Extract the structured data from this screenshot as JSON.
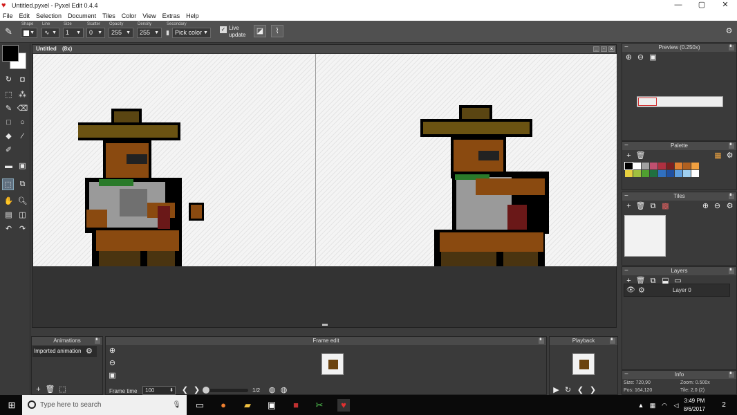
{
  "window": {
    "title": "Untitled.pyxel - Pyxel Edit 0.4.4",
    "minimize": "—",
    "maximize": "▢",
    "close": "✕"
  },
  "menu": [
    "File",
    "Edit",
    "Selection",
    "Document",
    "Tiles",
    "Color",
    "View",
    "Extras",
    "Help"
  ],
  "toolbar": {
    "shape_label": "Shape",
    "line_label": "Line",
    "size_label": "Size",
    "size_value": "1",
    "scatter_label": "Scatter",
    "scatter_value": "0",
    "opacity_label": "Opacity",
    "opacity_value": "255",
    "density_label": "Density",
    "density_value": "255",
    "secondary_label": "Secondary",
    "secondary_value": "Pick color",
    "live_update_line1": "Live",
    "live_update_line2": "update"
  },
  "document": {
    "title": "Untitled",
    "zoom": "(8x)"
  },
  "panels": {
    "preview": {
      "title": "Preview (0.250x)"
    },
    "palette": {
      "title": "Palette",
      "colors": [
        "#000000",
        "#ffffff",
        "#a0a0a0",
        "#c05070",
        "#b03040",
        "#7a2020",
        "#e08030",
        "#b06020",
        "#f0a040",
        "#e8d040",
        "#a0c040",
        "#50a030",
        "#207040",
        "#3070c0",
        "#2050a0",
        "#60a0e0",
        "#a0d0f0",
        "#ffffff"
      ]
    },
    "tiles": {
      "title": "Tiles"
    },
    "layers": {
      "title": "Layers",
      "items": [
        {
          "name": "Layer 0"
        }
      ]
    },
    "info": {
      "title": "Info",
      "size": "Size: 720,90",
      "zoom": "Zoom: 0.500x",
      "pos": "Pos: 164,120",
      "tile": "Tile: 2,0 (2)"
    },
    "animations": {
      "title": "Animations",
      "items": [
        {
          "name": "Imported animation"
        }
      ]
    },
    "frame_edit": {
      "title": "Frame edit",
      "frame_time_label": "Frame time",
      "frame_time_value": "100",
      "frame_counter": "1/2"
    },
    "playback": {
      "title": "Playback"
    }
  },
  "taskbar": {
    "search_placeholder": "Type here to search",
    "time": "3:49 PM",
    "date": "8/6/2017",
    "notifications": "2"
  }
}
